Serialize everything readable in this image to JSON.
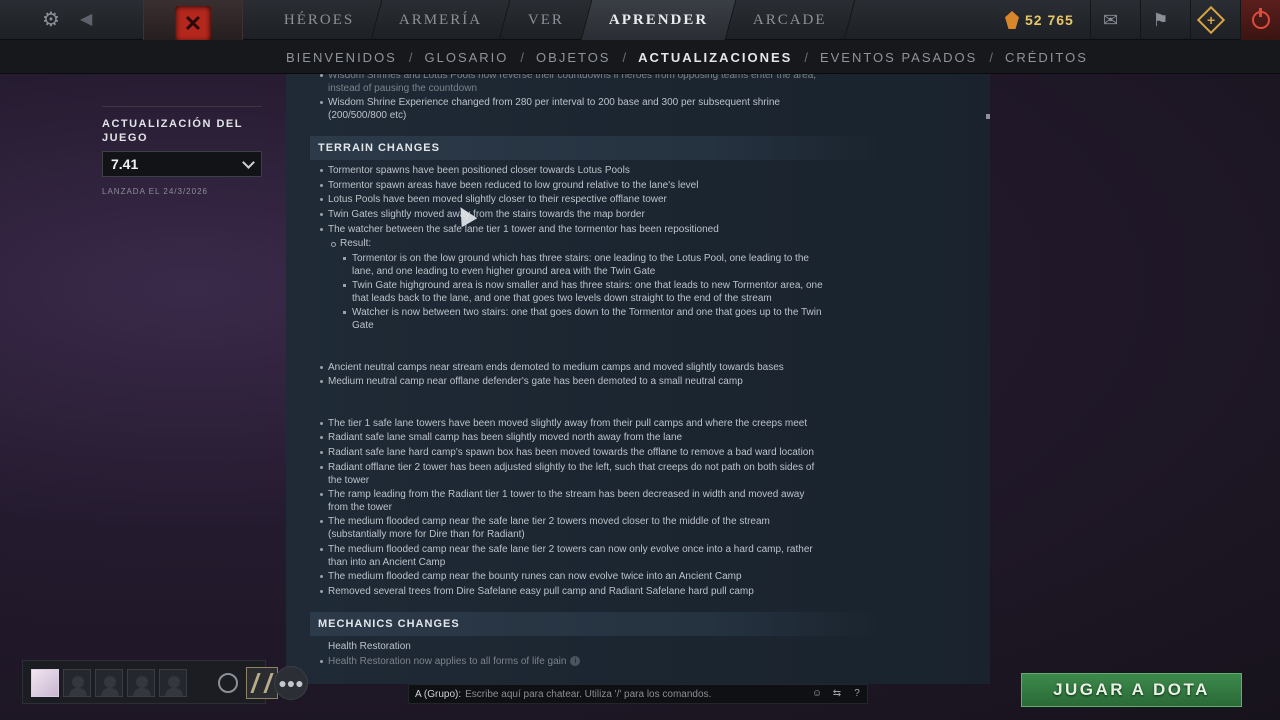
{
  "topnav": {
    "tabs": [
      "HÉROES",
      "ARMERÍA",
      "VER",
      "APRENDER",
      "ARCADE"
    ],
    "active_tab": "APRENDER",
    "currency": "52 765"
  },
  "subnav": {
    "items": [
      "BIENVENIDOS",
      "GLOSARIO",
      "OBJETOS",
      "ACTUALIZACIONES",
      "EVENTOS PASADOS",
      "CRÉDITOS"
    ],
    "separator": "/",
    "active": "ACTUALIZACIONES"
  },
  "left_panel": {
    "title": "ACTUALIZACIÓN DEL JUEGO",
    "version": "7.41",
    "launch_date": "LANZADA EL 24/3/2026"
  },
  "content": {
    "top_lines": [
      "Wisdom Shrines and Lotus Pools now reverse their countdowns if heroes from opposing teams enter the area,",
      "instead of pausing the countdown",
      "Wisdom Shrine Experience changed from 280 per interval to 200 base and 300 per subsequent shrine",
      "(200/500/800 etc)"
    ],
    "terrain_header": "TERRAIN CHANGES",
    "terrain_lines": [
      "Tormentor spawns have been positioned closer towards Lotus Pools",
      "Tormentor spawn areas have been reduced to low ground relative to the lane's level",
      "Lotus Pools have been moved slightly closer to their respective offlane tower",
      "Twin Gates slightly moved away from the stairs towards the map border",
      "The watcher between the safe lane tier 1 tower and the tormentor has been repositioned",
      "Result:",
      "Tormentor is on the low ground which has three stairs: one leading to the Lotus Pool, one leading to the",
      "lane, and one leading to even higher ground area with the Twin Gate",
      "Twin Gate highground area is now smaller and has three stairs: one that leads to new Tormentor area, one",
      "that leads back to the lane, and one that goes two levels down straight to the end of the stream",
      "Watcher is now between two stairs: one that goes down to the Tormentor and one that goes up to the Twin",
      "Gate",
      "Ancient neutral camps near stream ends demoted to medium camps and moved slightly towards bases",
      "Medium neutral camp near offlane defender's gate has been demoted to a small neutral camp",
      "The tier 1 safe lane towers have been moved slightly away from their pull camps and where the creeps meet",
      "Radiant safe lane small camp has been slightly moved north away from the lane",
      "Radiant safe lane hard camp's spawn box has been moved towards the offlane to remove a bad ward location",
      "Radiant offlane tier 2 tower has been adjusted slightly to the left, such that creeps do not path on both sides of",
      "the tower",
      "The ramp leading from the Radiant tier 1 tower to the stream has been decreased in width and moved away",
      "from the tower",
      "The medium flooded camp near the safe lane tier 2 towers moved closer to the middle of the stream",
      "(substantially more for Dire than for Radiant)",
      "The medium flooded camp near the safe lane tier 2 towers can now only evolve once into a hard camp, rather",
      "than into an Ancient Camp",
      "The medium flooded camp near the bounty runes can now evolve twice into an Ancient Camp",
      "Removed several trees from Dire Safelane easy pull camp and Radiant Safelane hard pull camp"
    ],
    "mechanics_header": "MECHANICS CHANGES",
    "mechanics_lines": [
      "Health Restoration",
      "Health Restoration now applies to all forms of life gain"
    ]
  },
  "bottom": {
    "chat_label": "A (Grupo):",
    "chat_placeholder": "Escribe aquí para chatear. Utiliza '/' para los comandos.",
    "help": "?",
    "play_button": "JUGAR A DOTA"
  }
}
